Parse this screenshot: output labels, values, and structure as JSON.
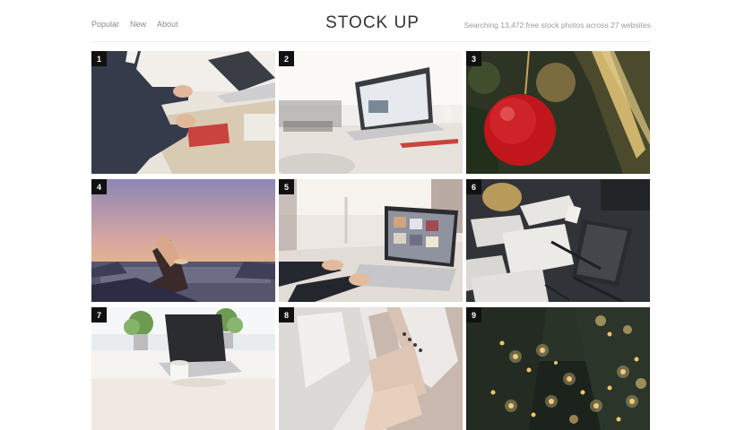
{
  "nav": {
    "items": [
      "Popular",
      "New",
      "About"
    ]
  },
  "brand": {
    "title": "STOCK UP"
  },
  "status": {
    "text": "Searching 13,472 free stock photos across 27 websites"
  },
  "photos": [
    {
      "number": "1"
    },
    {
      "number": "2"
    },
    {
      "number": "3"
    },
    {
      "number": "4"
    },
    {
      "number": "5"
    },
    {
      "number": "6"
    },
    {
      "number": "7"
    },
    {
      "number": "8"
    },
    {
      "number": "9"
    }
  ]
}
